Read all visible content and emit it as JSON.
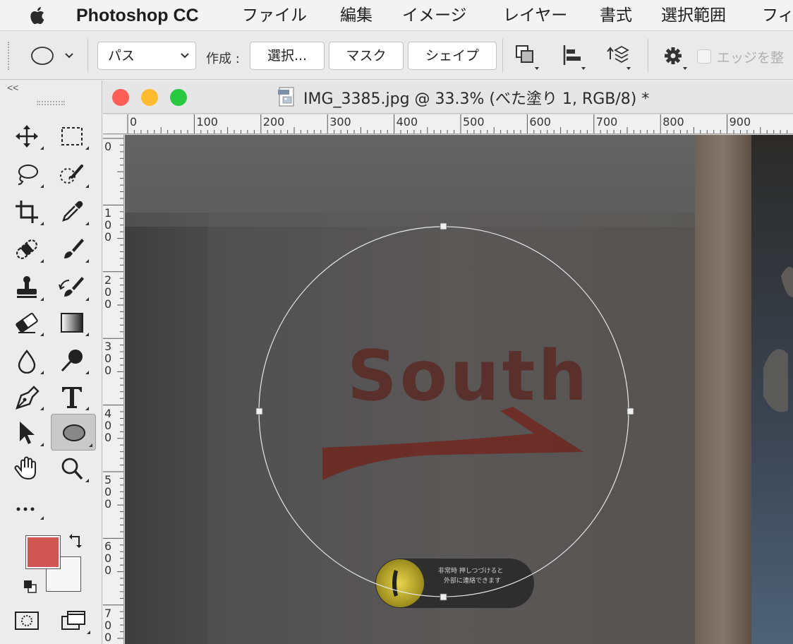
{
  "menubar": {
    "app_name": "Photoshop CC",
    "items": [
      "ファイル",
      "編集",
      "イメージ",
      "レイヤー",
      "書式",
      "選択範囲",
      "フィ"
    ]
  },
  "options_bar": {
    "mode_select": "パス",
    "create_label": "作成 :",
    "buttons": {
      "selection": "選択...",
      "mask": "マスク",
      "shape": "シェイプ"
    },
    "edge_checkbox_label": "エッジを整",
    "edge_checkbox_checked": false
  },
  "toolbox": {
    "collapse_label": "<<",
    "active_tool": "ellipse-tool",
    "foreground_color": "#d05553",
    "background_color": "#f7f7f7"
  },
  "document": {
    "title": "IMG_3385.jpg @ 33.3% (べた塗り 1, RGB/8) *",
    "traffic_lights": {
      "close": "#fd5f57",
      "minimize": "#febc2e",
      "zoom": "#28c840"
    },
    "ruler_top": [
      "0",
      "100",
      "200",
      "300",
      "400",
      "500",
      "600",
      "700",
      "800",
      "900"
    ],
    "ruler_left": [
      [
        "0"
      ],
      [
        "1",
        "0",
        "0"
      ],
      [
        "2",
        "0",
        "0"
      ],
      [
        "3",
        "0",
        "0"
      ],
      [
        "4",
        "0",
        "0"
      ],
      [
        "5",
        "0",
        "0"
      ],
      [
        "6",
        "0",
        "0"
      ],
      [
        "7",
        "0",
        "0"
      ]
    ]
  },
  "image": {
    "sign_text": "South",
    "emergency_line1": "非常時 押しつづけると",
    "emergency_line2": "外部に連絡できます"
  }
}
